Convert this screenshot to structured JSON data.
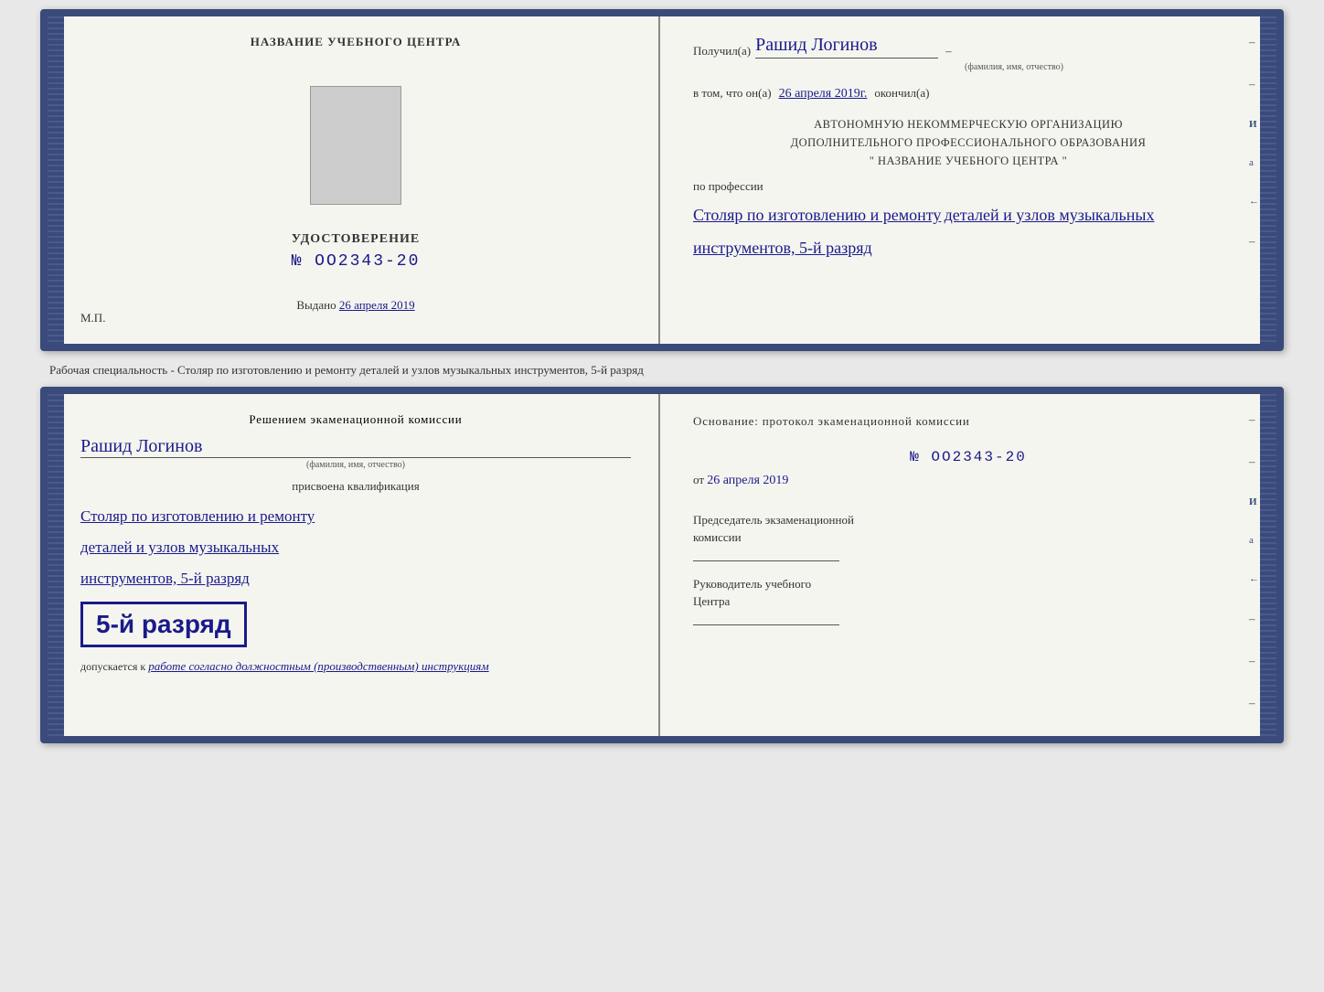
{
  "top_doc": {
    "left": {
      "org_name": "НАЗВАНИЕ УЧЕБНОГО ЦЕНТРА",
      "cert_title": "УДОСТОВЕРЕНИЕ",
      "cert_number": "№ OO2343-20",
      "issued_label": "Выдано",
      "issued_date": "26 апреля 2019",
      "mp_label": "М.П."
    },
    "right": {
      "received_label": "Получил(а)",
      "recipient_name": "Рашид Логинов",
      "recipient_sublabel": "(фамилия, имя, отчество)",
      "date_prefix": "в том, что он(а)",
      "date_value": "26 апреля 2019г.",
      "date_suffix": "окончил(а)",
      "org_line1": "АВТОНОМНУЮ НЕКОММЕРЧЕСКУЮ ОРГАНИЗАЦИЮ",
      "org_line2": "ДОПОЛНИТЕЛЬНОГО ПРОФЕССИОНАЛЬНОГО ОБРАЗОВАНИЯ",
      "org_line3": "\" НАЗВАНИЕ УЧЕБНОГО ЦЕНТРА \"",
      "profession_label": "по профессии",
      "profession_line1": "Столяр по изготовлению и ремонту",
      "profession_line2": "деталей и узлов музыкальных",
      "profession_line3": "инструментов, 5-й разряд"
    }
  },
  "specialty_label": "Рабочая специальность - Столяр по изготовлению и ремонту деталей и узлов музыкальных инструментов, 5-й разряд",
  "bottom_doc": {
    "left": {
      "commission_text": "Решением экаменационной комиссии",
      "person_name": "Рашид Логинов",
      "person_sublabel": "(фамилия, имя, отчество)",
      "assigned_text": "присвоена квалификация",
      "qual_line1": "Столяр по изготовлению и ремонту",
      "qual_line2": "деталей и узлов музыкальных",
      "qual_line3": "инструментов, 5-й разряд",
      "rank_badge": "5-й разряд",
      "admitted_prefix": "допускается к",
      "admitted_text": "работе согласно должностным (производственным) инструкциям"
    },
    "right": {
      "basis_text": "Основание: протокол экаменационной комиссии",
      "protocol_number": "№ OO2343-20",
      "date_prefix": "от",
      "date_value": "26 апреля 2019",
      "chairman_line1": "Председатель экзаменационной",
      "chairman_line2": "комиссии",
      "director_line1": "Руководитель учебного",
      "director_line2": "Центра"
    }
  },
  "side_marks": {
    "items": [
      "И",
      "а",
      "←",
      "–",
      "–",
      "–",
      "–"
    ]
  }
}
